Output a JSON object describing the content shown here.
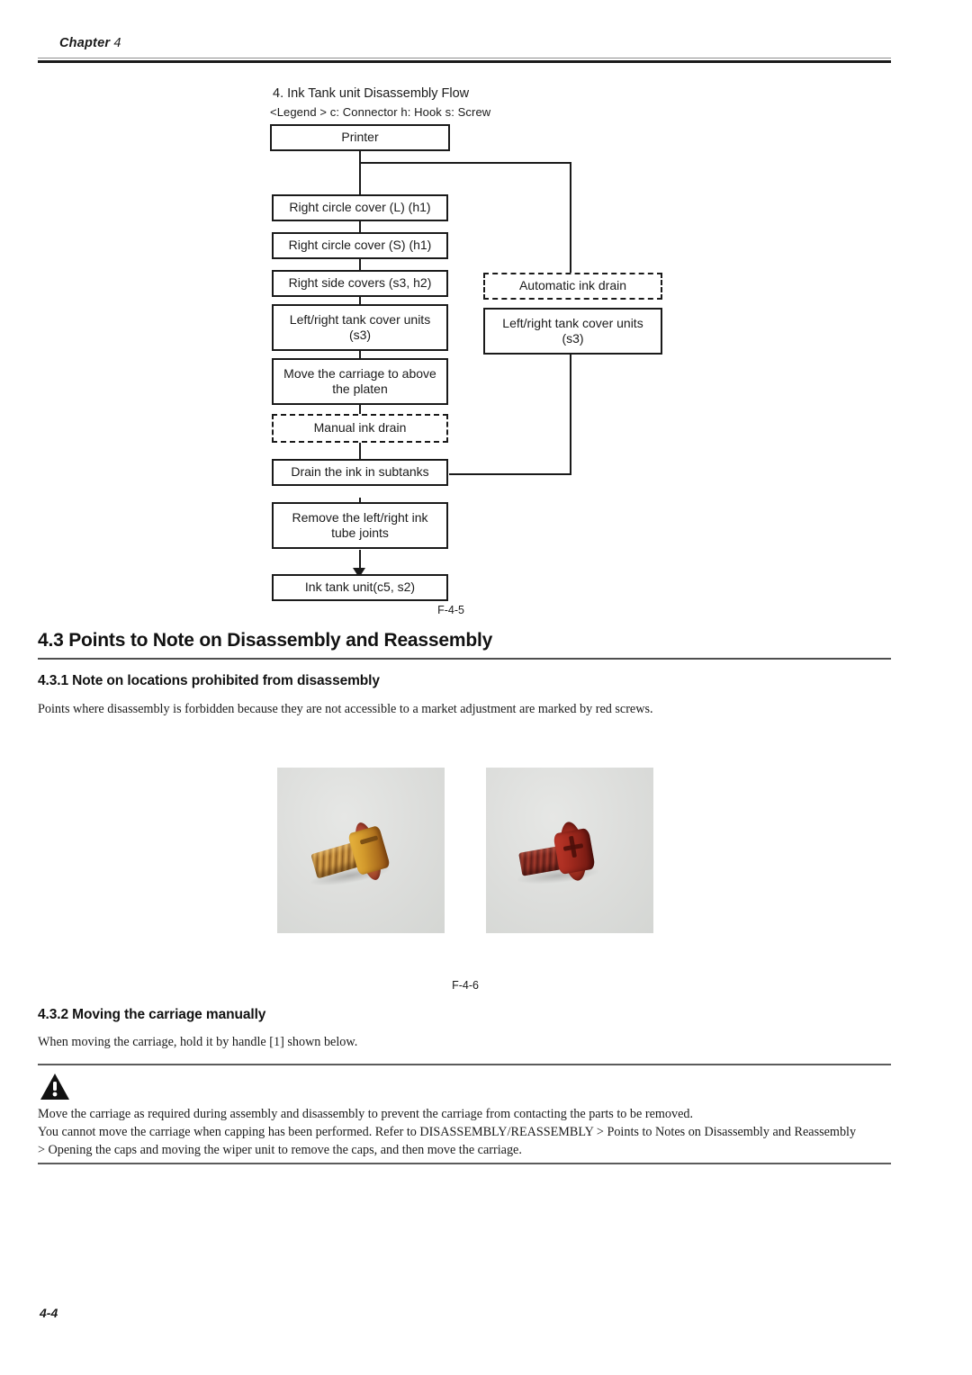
{
  "header": {
    "chapter_label": "Chapter",
    "chapter_number": "4"
  },
  "figure_flow": {
    "title": "4. Ink Tank unit Disassembly Flow",
    "legend": "<Legend > c: Connector  h: Hook  s: Screw",
    "caption": "F-4-5",
    "nodes": {
      "printer": "Printer",
      "right_circle_cover_l": "Right circle cover (L) (h1)",
      "right_circle_cover_s": "Right circle cover (S) (h1)",
      "right_side_covers": "Right side covers (s3, h2)",
      "left_right_tank_cover_units_main": "Left/right tank cover units (s3)",
      "move_carriage": "Move the carriage to above the platen",
      "manual_ink_drain": "Manual ink drain",
      "drain_ink_subtanks": "Drain the ink in subtanks",
      "remove_ink_tube_joints": "Remove the left/right ink tube joints",
      "ink_tank_unit": "Ink tank unit(c5, s2)",
      "automatic_ink_drain": "Automatic ink drain",
      "left_right_tank_cover_units_branch": "Left/right tank cover units (s3)"
    }
  },
  "section": {
    "number": "4.3",
    "title": "4.3 Points to Note on Disassembly and Reassembly"
  },
  "subsection_1": {
    "title": "4.3.1 Note on locations prohibited from disassembly",
    "body": "Points where disassembly is forbidden because they are not accessible to a market adjustment are marked by red screws."
  },
  "figure_screws": {
    "caption": "F-4-6",
    "photo_left_alt": "gold-plated screw",
    "photo_right_alt": "red-painted screw"
  },
  "subsection_2": {
    "title": "4.3.2 Moving the carriage manually",
    "body": "When moving the carriage, hold it by handle [1] shown below."
  },
  "warning": {
    "icon": "warning-triangle-icon",
    "line1": "Move the carriage as required during assembly and disassembly to prevent the carriage from contacting the parts to be removed.",
    "line2": "You cannot move the carriage when capping has been performed. Refer to DISASSEMBLY/REASSEMBLY > Points to Notes on Disassembly and Reassembly",
    "line3": "> Opening the caps and moving the wiper unit to remove the caps, and then move the carriage."
  },
  "footer": {
    "page_number": "4-4"
  },
  "colors": {
    "rule_dark": "#1a1a1a",
    "rule_gray": "#5b5b5b",
    "text": "#1a1a1a"
  }
}
